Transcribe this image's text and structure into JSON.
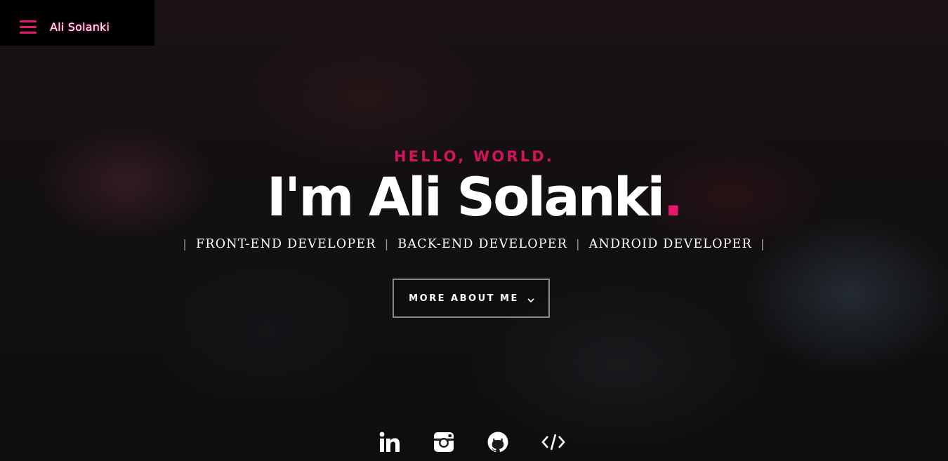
{
  "header": {
    "brand_name": "Ali Solanki",
    "menu_icon": "hamburger-menu-icon",
    "accent_color": "#e8176f"
  },
  "hero": {
    "eyebrow": "HELLO, WORLD.",
    "headline_prefix": "I'm Ali Solanki",
    "headline_dot": ".",
    "roles": [
      "FRONT-END DEVELOPER",
      "BACK-END DEVELOPER",
      "ANDROID DEVELOPER"
    ],
    "separator": "|",
    "cta_label": "MORE ABOUT ME",
    "cta_icon": "chevron-down-icon"
  },
  "social": [
    {
      "name": "linkedin",
      "icon": "linkedin-icon"
    },
    {
      "name": "instagram",
      "icon": "instagram-icon"
    },
    {
      "name": "github",
      "icon": "github-icon"
    },
    {
      "name": "code",
      "icon": "code-icon"
    }
  ],
  "colors": {
    "accent": "#e8176f",
    "eyebrow": "#d4125e",
    "text": "#ffffff",
    "button_border": "#8a8a8a"
  }
}
